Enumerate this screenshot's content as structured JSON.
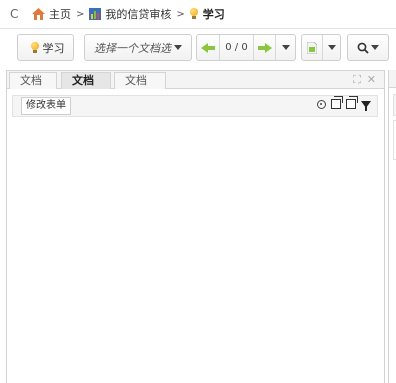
{
  "breadcrumb": {
    "items": [
      "主页",
      "我的信贷审核",
      "学习"
    ],
    "separator": ">"
  },
  "toolbar": {
    "learn_label": "学习",
    "doc_selector_label": "选择一个文档选",
    "page_counter": "0 / 0"
  },
  "panel": {
    "tabs": [
      "文档",
      "文档",
      "文档"
    ],
    "active_tab_index": 1,
    "edit_form_label": "修改表单"
  },
  "colors": {
    "accent_green": "#8cc63f",
    "bulb_yellow": "#f5a20f"
  }
}
